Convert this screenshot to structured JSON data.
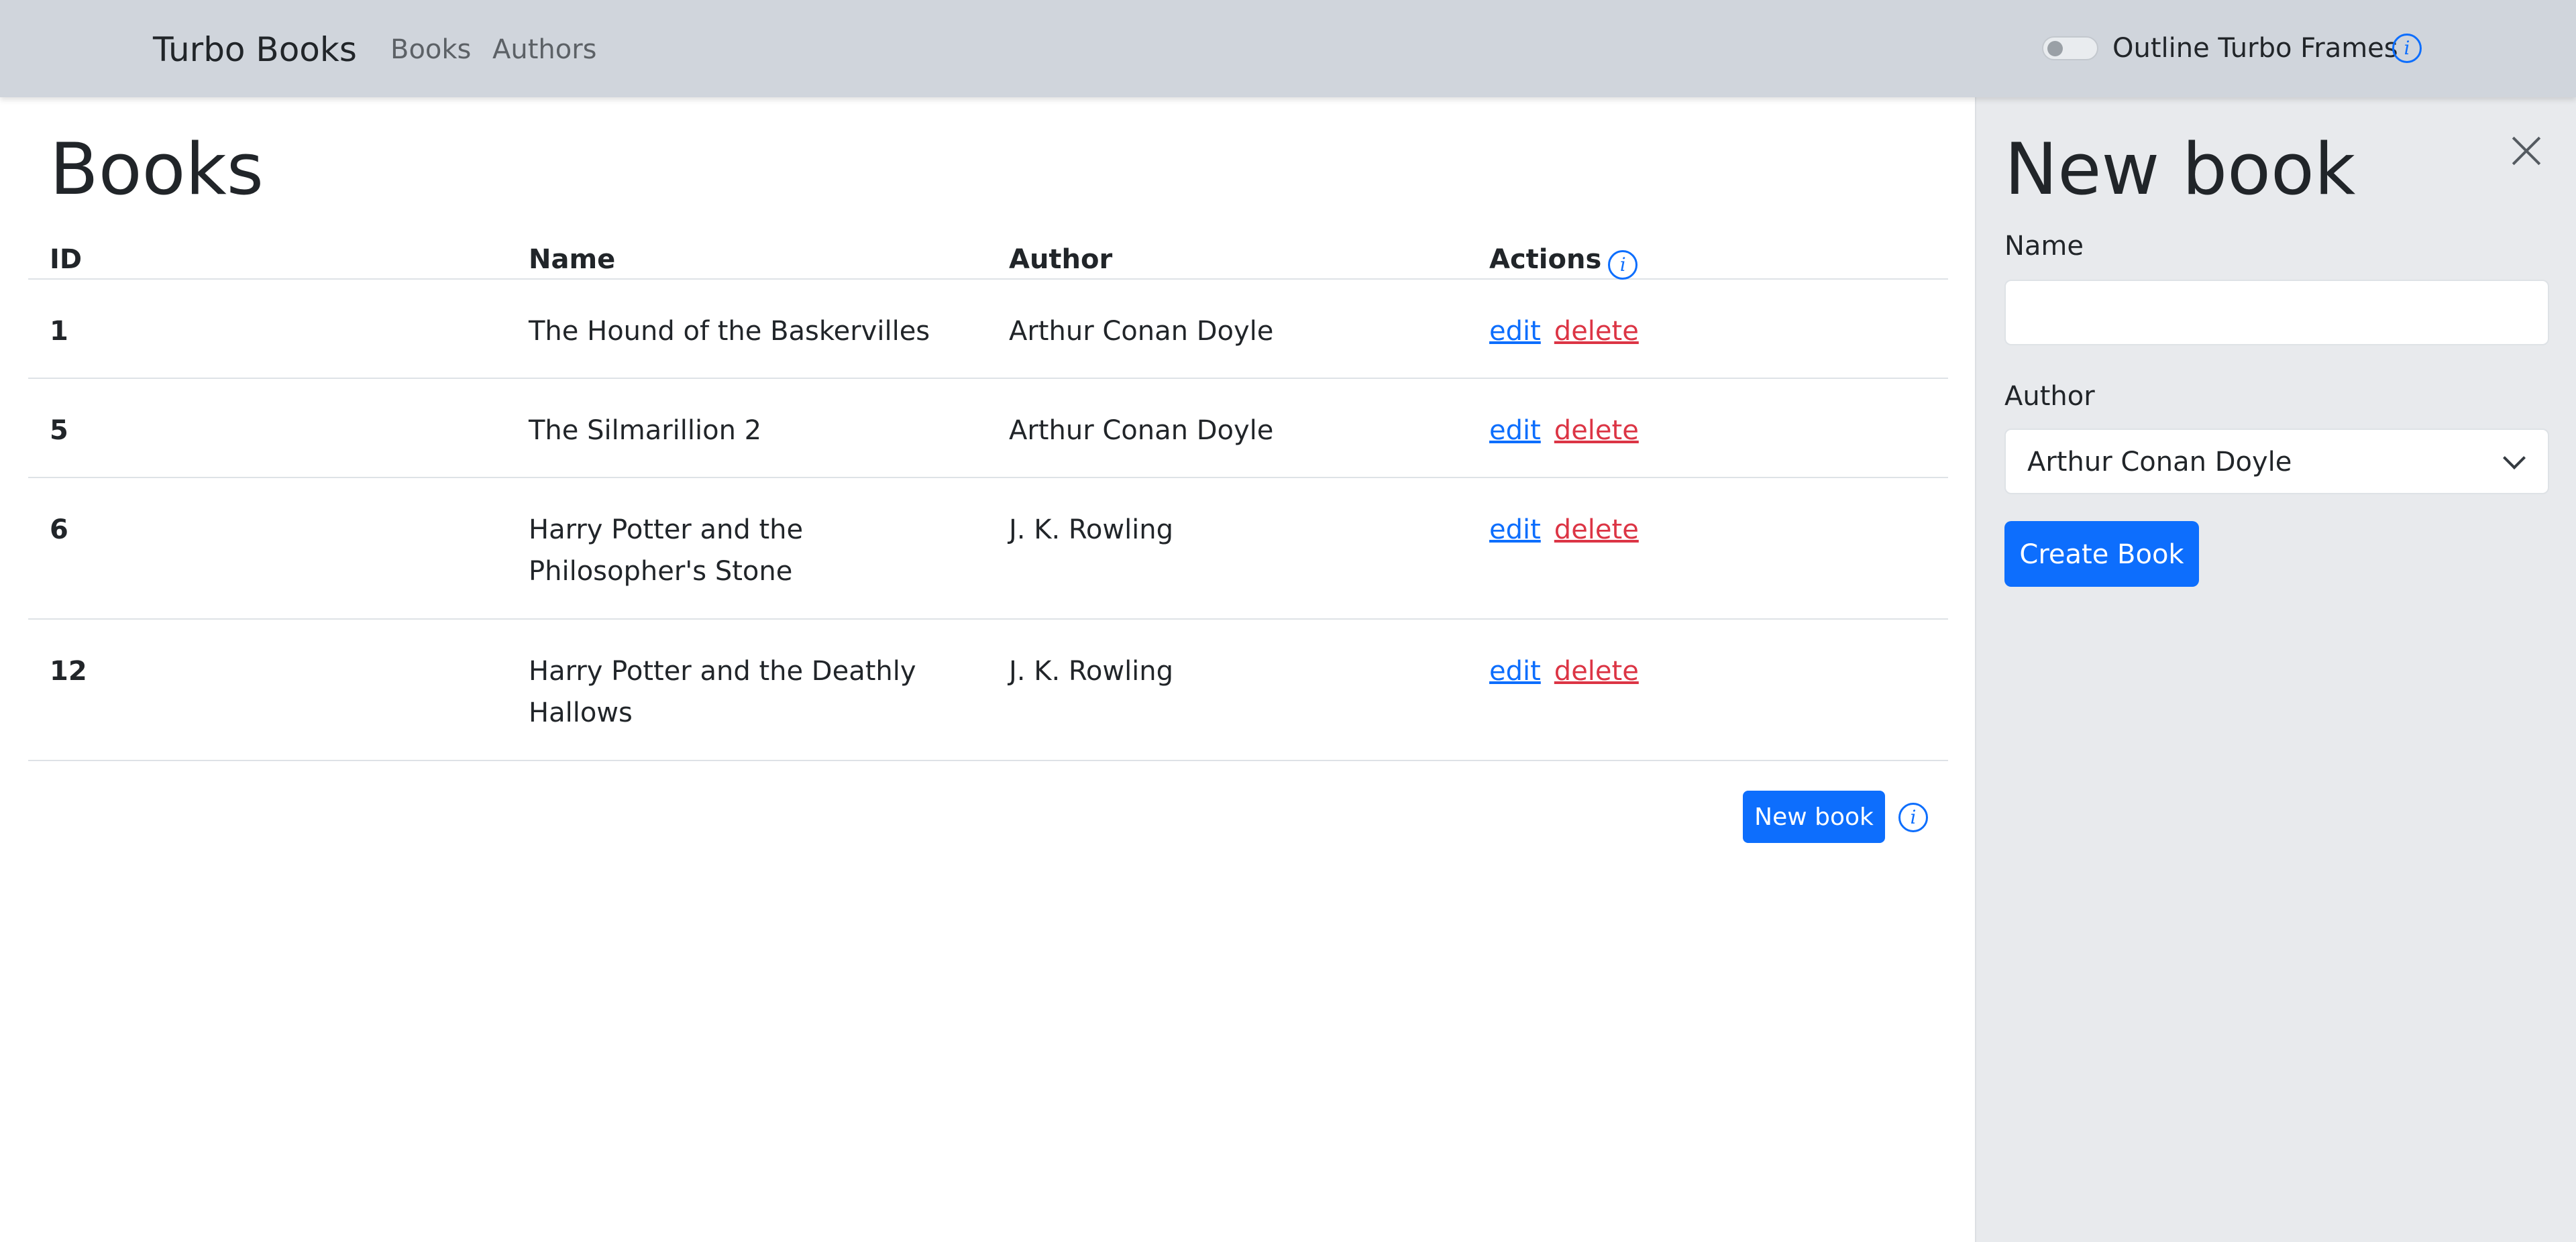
{
  "navbar": {
    "brand": "Turbo Books",
    "links": [
      {
        "label": "Books"
      },
      {
        "label": "Authors"
      }
    ],
    "toggle_label": "Outline Turbo Frames",
    "info_glyph": "i",
    "toggle_on": false
  },
  "main": {
    "title": "Books",
    "columns": [
      "ID",
      "Name",
      "Author",
      "Actions"
    ],
    "rows": [
      {
        "id": "1",
        "name": "The Hound of the Baskervilles",
        "author": "Arthur Conan Doyle",
        "edit": "edit",
        "delete": "delete"
      },
      {
        "id": "5",
        "name": "The Silmarillion 2",
        "author": "Arthur Conan Doyle",
        "edit": "edit",
        "delete": "delete"
      },
      {
        "id": "6",
        "name": "Harry Potter and the Philosopher's Stone",
        "author": "J. K. Rowling",
        "edit": "edit",
        "delete": "delete"
      },
      {
        "id": "12",
        "name": "Harry Potter and the Deathly Hallows",
        "author": "J. K. Rowling",
        "edit": "edit",
        "delete": "delete"
      }
    ],
    "new_book_label": "New book",
    "info_glyph": "i"
  },
  "panel": {
    "title": "New book",
    "name_label": "Name",
    "name_value": "",
    "name_placeholder": "",
    "author_label": "Author",
    "author_selected": "Arthur Conan Doyle",
    "submit_label": "Create Book"
  },
  "colors": {
    "primary": "#0d6efd",
    "danger": "#dc3545",
    "navbar_bg": "#d0d5dc",
    "panel_bg": "#e8eaed"
  },
  "icons": [
    "info-icon",
    "close-icon",
    "chevron-down-icon",
    "toggle-switch"
  ]
}
